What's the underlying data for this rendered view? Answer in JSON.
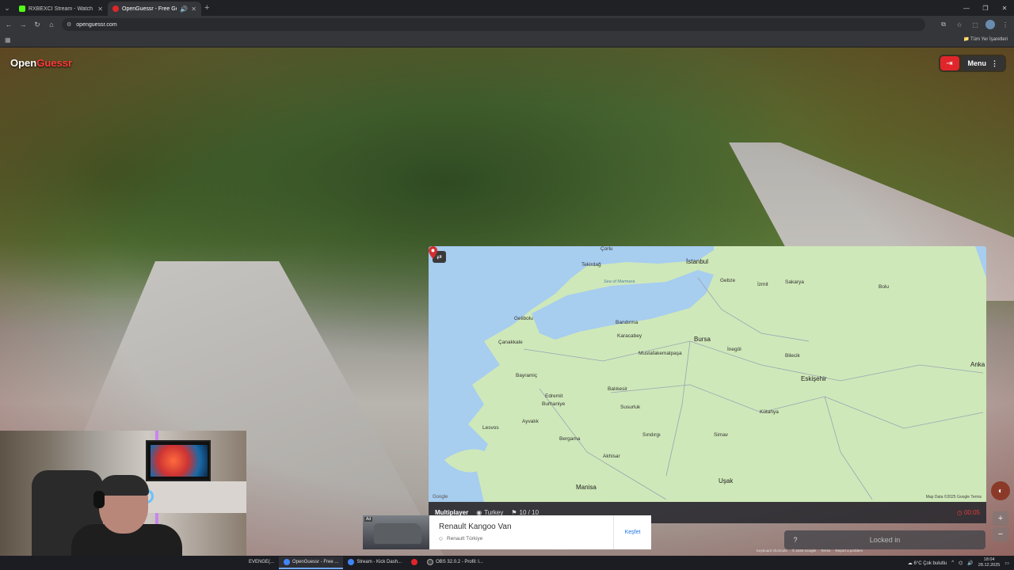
{
  "browser": {
    "tabs": [
      {
        "title": "RXBEXCI Stream - Watch Live o",
        "favicon_color": "#53fc18",
        "active": false
      },
      {
        "title": "OpenGuessr - Free GeoGue",
        "favicon_color": "#e0262b",
        "active": true
      }
    ],
    "url": "openguessr.com",
    "bookmarks_all": "Tüm Yer İşaretleri"
  },
  "game": {
    "logo_part1": "Open",
    "logo_part2": "Guessr",
    "menu_label": "Menu",
    "status": {
      "mode": "Multiplayer",
      "country": "Turkey",
      "round": "10 / 10",
      "timer": "00:05"
    },
    "locked_label": "Locked in",
    "help_label": "?",
    "zoom_in": "+",
    "zoom_out": "−",
    "attribution": [
      "Keyboard shortcuts",
      "© 2025 Google",
      "Terms",
      "Report a problem"
    ]
  },
  "map": {
    "google_label": "Google",
    "credit": "Map Data ©2025 Google    Terms",
    "labels": {
      "corlu": "Çorlu",
      "istanbul": "İstanbul",
      "tekirdag": "Tekirdağ",
      "marmara": "Sea of Marmara",
      "gebze": "Gebze",
      "izmit": "İzmit",
      "sakarya": "Sakarya",
      "bolu": "Bolu",
      "bandirma": "Bandırma",
      "bursa": "Bursa",
      "inegol": "İnegöl",
      "canakkale": "Çanakkale",
      "balikesir": "Balıkesir",
      "eskisehir": "Eskişehir",
      "kutahya": "Kütahya",
      "edremit": "Edremit",
      "manisa": "Manisa",
      "usak": "Uşak",
      "ankara": "Anka",
      "burhaniye": "Burhaniye",
      "ayvalik": "Ayvalık",
      "bergama": "Bergama",
      "lesvos": "Lesvos",
      "akhisar": "Akhisar",
      "susurluk": "Susurluk",
      "bilecik": "Bilecik",
      "mustafakemalpasa": "Mustafakemalpaşa",
      "gelibolu": "Gelibolu",
      "karacabey": "Karacabey",
      "sindirgi": "Sındırgı",
      "simav": "Simav",
      "bayramic": "Bayramiç"
    }
  },
  "ad": {
    "badge": "Ad",
    "title": "Renault Kangoo Van",
    "brand": "Renault Türkiye",
    "cta": "Keşfet"
  },
  "taskbar": {
    "items": [
      {
        "label": "EVENGE(...",
        "color": "#888",
        "active": false
      },
      {
        "label": "OpenGuessr - Free ...",
        "color": "#4285f4",
        "active": true
      },
      {
        "label": "Stream - Kick Dash...",
        "color": "#4285f4",
        "active": false
      },
      {
        "label": "",
        "color": "#e0262b",
        "active": false
      },
      {
        "label": "OBS 32.0.2 - Profil: l...",
        "color": "#444",
        "active": false
      }
    ],
    "weather": "6°C  Çok bulutlu",
    "time": "18:04",
    "date": "28.12.2025"
  }
}
